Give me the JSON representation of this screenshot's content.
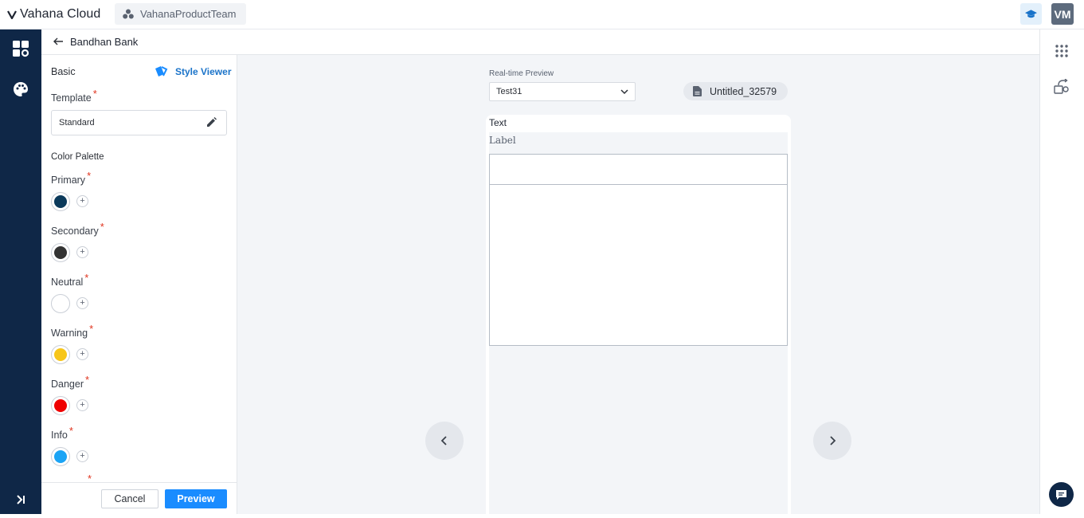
{
  "header": {
    "app_name": "Vahana Cloud",
    "team": "VahanaProductTeam",
    "avatar_initials": "VM"
  },
  "breadcrumb": {
    "title": "Bandhan Bank"
  },
  "panel": {
    "tab_label": "Basic",
    "style_viewer_label": "Style Viewer",
    "template_label": "Template",
    "template_value": "Standard",
    "color_palette_label": "Color Palette",
    "required_mark": "*",
    "colors": [
      {
        "label": "Primary",
        "hex": "#0b3a5b"
      },
      {
        "label": "Secondary",
        "hex": "#333333"
      },
      {
        "label": "Neutral",
        "hex": "#ffffff"
      },
      {
        "label": "Warning",
        "hex": "#f7c61a"
      },
      {
        "label": "Danger",
        "hex": "#ef0000"
      },
      {
        "label": "Info",
        "hex": "#1ba4f5"
      }
    ],
    "cancel_label": "Cancel",
    "preview_label": "Preview"
  },
  "preview": {
    "realtime_label": "Real-time Preview",
    "selected_form": "Test31",
    "file_name": "Untitled_32579",
    "component_title": "Text",
    "field_label": "Label"
  },
  "theme": {
    "rail_bg": "#0f2747",
    "accent": "#1a8cff",
    "link": "#1a73c9"
  }
}
